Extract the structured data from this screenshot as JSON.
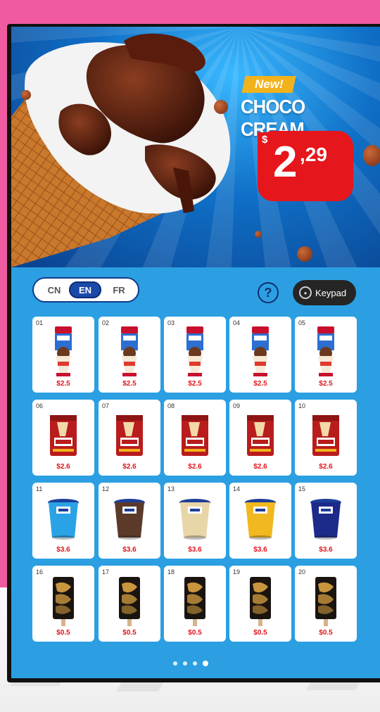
{
  "banner": {
    "badge": "New!",
    "product_name": "CHOCO CREAM",
    "price_currency": "$",
    "price_main": "2",
    "price_cents": ",29"
  },
  "languages": [
    {
      "code": "CN",
      "active": false
    },
    {
      "code": "EN",
      "active": true
    },
    {
      "code": "FR",
      "active": false
    }
  ],
  "help_label": "?",
  "keypad_label": "Keypad",
  "products": [
    {
      "slot": "01",
      "price": "$2.5",
      "kind": "cup"
    },
    {
      "slot": "02",
      "price": "$2.5",
      "kind": "cup"
    },
    {
      "slot": "03",
      "price": "$2.5",
      "kind": "cup"
    },
    {
      "slot": "04",
      "price": "$2.5",
      "kind": "cup"
    },
    {
      "slot": "05",
      "price": "$2.5",
      "kind": "cup"
    },
    {
      "slot": "06",
      "price": "$2.6",
      "kind": "bag"
    },
    {
      "slot": "07",
      "price": "$2.6",
      "kind": "bag"
    },
    {
      "slot": "08",
      "price": "$2.6",
      "kind": "bag"
    },
    {
      "slot": "09",
      "price": "$2.6",
      "kind": "bag"
    },
    {
      "slot": "10",
      "price": "$2.6",
      "kind": "bag"
    },
    {
      "slot": "11",
      "price": "$3.6",
      "kind": "tub",
      "color": "#2aa3e6"
    },
    {
      "slot": "12",
      "price": "$3.6",
      "kind": "tub",
      "color": "#5b3a2a"
    },
    {
      "slot": "13",
      "price": "$3.6",
      "kind": "tub",
      "color": "#e8d6a8"
    },
    {
      "slot": "14",
      "price": "$3.6",
      "kind": "tub",
      "color": "#f1b81f"
    },
    {
      "slot": "15",
      "price": "$3.6",
      "kind": "tub",
      "color": "#1c2a8a"
    },
    {
      "slot": "16",
      "price": "$0.5",
      "kind": "bar"
    },
    {
      "slot": "17",
      "price": "$0.5",
      "kind": "bar"
    },
    {
      "slot": "18",
      "price": "$0.5",
      "kind": "bar"
    },
    {
      "slot": "19",
      "price": "$0.5",
      "kind": "bar"
    },
    {
      "slot": "20",
      "price": "$0.5",
      "kind": "bar"
    }
  ],
  "pager": {
    "count": 4,
    "active": 4
  },
  "colors": {
    "background": "#ef5aa1",
    "screen": "#2b9fe2",
    "price_red": "#e5161c",
    "badge_yellow": "#f2b21b"
  }
}
